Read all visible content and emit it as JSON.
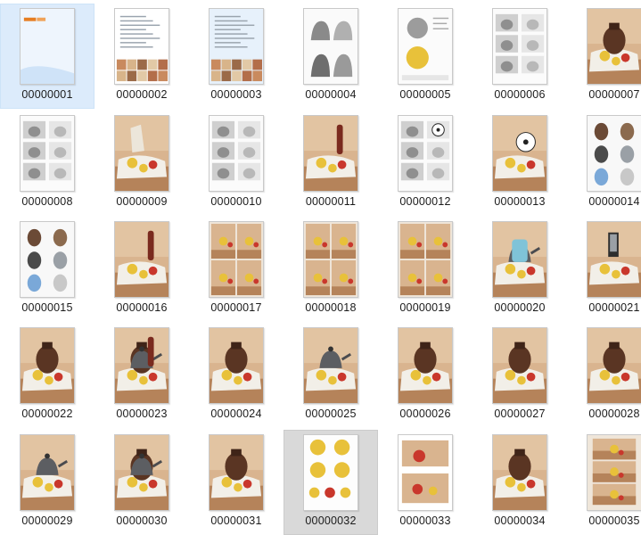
{
  "window": {
    "view": "large-icons",
    "item_count_visible": 35
  },
  "files": [
    {
      "name": "00000001",
      "thumb": "cover-blue",
      "selected": "blue"
    },
    {
      "name": "00000002",
      "thumb": "text-with-photo-strip"
    },
    {
      "name": "00000003",
      "thumb": "blue-text-photo-strip"
    },
    {
      "name": "00000004",
      "thumb": "kettle-sketches"
    },
    {
      "name": "00000005",
      "thumb": "apple-sketch-page"
    },
    {
      "name": "00000006",
      "thumb": "sketch-grid-page"
    },
    {
      "name": "00000007",
      "thumb": "still-life-jar"
    },
    {
      "name": "00000008",
      "thumb": "sketch-grid-page"
    },
    {
      "name": "00000009",
      "thumb": "still-life-pears"
    },
    {
      "name": "00000010",
      "thumb": "sketch-grid-page"
    },
    {
      "name": "00000011",
      "thumb": "still-life-bottle-color"
    },
    {
      "name": "00000012",
      "thumb": "sketch-grid-ball"
    },
    {
      "name": "00000013",
      "thumb": "still-life-soccer"
    },
    {
      "name": "00000014",
      "thumb": "still-life-jars-grid"
    },
    {
      "name": "00000015",
      "thumb": "still-life-jars-grid"
    },
    {
      "name": "00000016",
      "thumb": "still-life-cola"
    },
    {
      "name": "00000017",
      "thumb": "still-life-collage"
    },
    {
      "name": "00000018",
      "thumb": "still-life-collage"
    },
    {
      "name": "00000019",
      "thumb": "still-life-collage"
    },
    {
      "name": "00000020",
      "thumb": "still-life-kettle-blue"
    },
    {
      "name": "00000021",
      "thumb": "still-life-blender"
    },
    {
      "name": "00000022",
      "thumb": "still-life-jar"
    },
    {
      "name": "00000023",
      "thumb": "still-life-teapot-bottle"
    },
    {
      "name": "00000024",
      "thumb": "still-life-pot"
    },
    {
      "name": "00000025",
      "thumb": "still-life-kettle"
    },
    {
      "name": "00000026",
      "thumb": "still-life-jug"
    },
    {
      "name": "00000027",
      "thumb": "still-life-jar"
    },
    {
      "name": "00000028",
      "thumb": "still-life-jug"
    },
    {
      "name": "00000029",
      "thumb": "still-life-kettle"
    },
    {
      "name": "00000030",
      "thumb": "still-life-teapot"
    },
    {
      "name": "00000031",
      "thumb": "still-life-pot"
    },
    {
      "name": "00000032",
      "thumb": "fruit-grid",
      "selected": "gray"
    },
    {
      "name": "00000033",
      "thumb": "still-life-apples"
    },
    {
      "name": "00000034",
      "thumb": "still-life-jar"
    },
    {
      "name": "00000035",
      "thumb": "still-life-collage-vertical"
    }
  ],
  "colors": {
    "selection_blue": "#dcebfb",
    "selection_gray": "#d9d9d9",
    "wood": "#b5835a",
    "wall": "#d9b48f",
    "cloth": "#f2efe8",
    "apple_yellow": "#e8c13a",
    "apple_red": "#c9372c",
    "jar_brown": "#5a3523"
  }
}
